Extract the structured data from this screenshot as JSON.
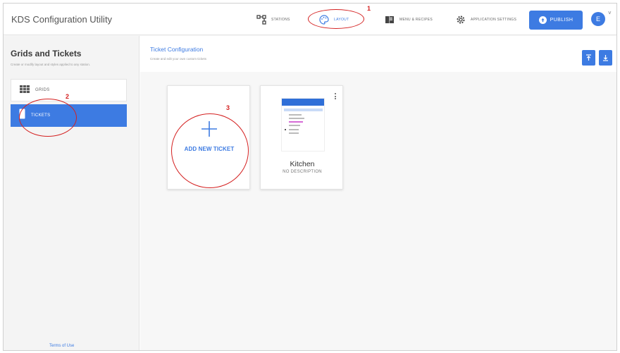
{
  "app": {
    "title": "KDS Configuration Utility"
  },
  "nav": {
    "stations": "STATIONS",
    "layout": "LAYOUT",
    "menu_recipes": "MENU & RECIPES",
    "app_settings": "APPLICATION SETTINGS",
    "publish": "PUBLISH",
    "avatar_initial": "E"
  },
  "sidebar": {
    "title": "Grids and Tickets",
    "subtitle": "Create or modify layout and styles applied to any station.",
    "items": [
      {
        "label": "GRIDS"
      },
      {
        "label": "TICKETS"
      }
    ],
    "terms": "Terms of Use"
  },
  "main": {
    "title": "Ticket Configuration",
    "subtitle": "Create and edit your own custom tickets"
  },
  "cards": {
    "add_label": "ADD NEW TICKET",
    "kitchen": {
      "title": "Kitchen",
      "description": "NO DESCRIPTION"
    }
  },
  "annotations": [
    "1",
    "2",
    "3"
  ],
  "colors": {
    "accent": "#3d7be2",
    "annotation": "#d42020"
  }
}
